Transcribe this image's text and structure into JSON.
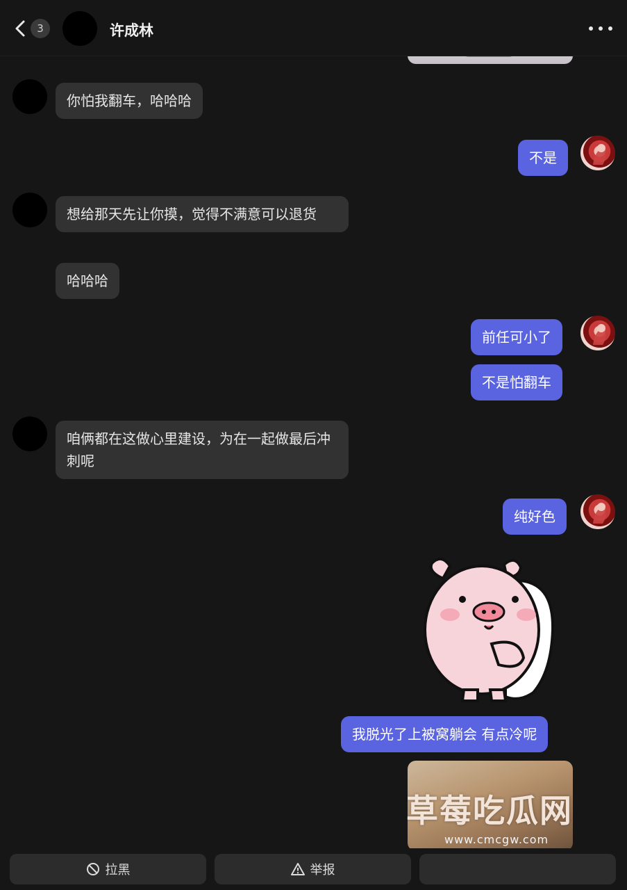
{
  "header": {
    "back_count": "3",
    "title": "许成林"
  },
  "messages": [
    {
      "side": "in",
      "text": "你怕我翻车，哈哈哈"
    },
    {
      "side": "out",
      "text": "不是"
    },
    {
      "side": "in",
      "text": "想给那天先让你摸，觉得不满意可以退货"
    },
    {
      "side": "in",
      "text": "哈哈哈"
    },
    {
      "side": "out",
      "text": "前任可小了"
    },
    {
      "side": "out",
      "text": "不是怕翻车"
    },
    {
      "side": "in",
      "text": "咱俩都在这做心里建设，为在一起做最后冲刺呢"
    },
    {
      "side": "out",
      "text": "纯好色"
    },
    {
      "side": "out",
      "text": "我脱光了上被窝躺会 有点冷呢"
    }
  ],
  "watermark": {
    "title": "草莓吃瓜网",
    "url": "www.cmcgw.com"
  },
  "actions": {
    "block_label": "拉黑",
    "report_label": "举报"
  },
  "colors": {
    "background": "#161616",
    "incoming_bubble": "#323232",
    "outgoing_bubble": "#5a63e0"
  }
}
